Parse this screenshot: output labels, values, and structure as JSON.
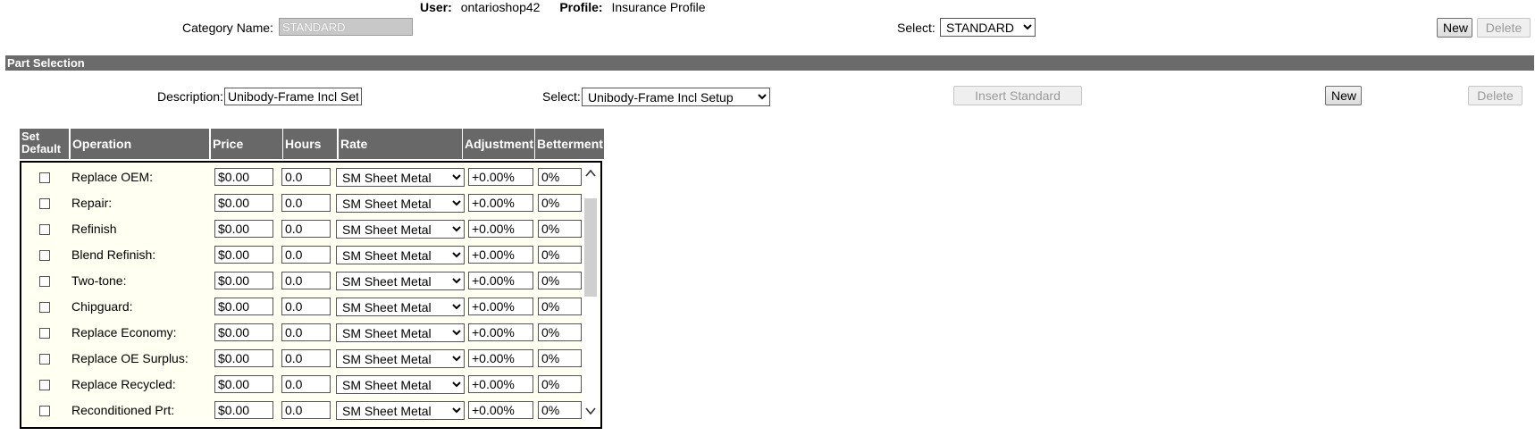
{
  "header": {
    "user_label": "User:",
    "user_value": "ontarioshop42",
    "profile_label": "Profile:",
    "profile_value": "Insurance Profile",
    "category_label": "Category Name:",
    "category_value": "STANDARD",
    "select_label": "Select:",
    "select_value": "STANDARD",
    "new_label": "New",
    "delete_label": "Delete"
  },
  "part_selection": {
    "title": "Part Selection",
    "description_label": "Description:",
    "description_value": "Unibody-Frame Incl Setup",
    "select_label": "Select:",
    "select_value": "Unibody-Frame Incl Setup",
    "insert_standard_label": "Insert Standard",
    "new_label": "New",
    "delete_label": "Delete"
  },
  "table": {
    "columns": {
      "set_default": "Set Default",
      "set_default_line1": "Set",
      "set_default_line2": "Default",
      "operation": "Operation",
      "price": "Price",
      "hours": "Hours",
      "rate": "Rate",
      "adjustment": "Adjustment",
      "betterment": "Betterment"
    },
    "rows": [
      {
        "operation": "Replace OEM:",
        "price": "$0.00",
        "hours": "0.0",
        "rate": "SM Sheet Metal",
        "adjustment": "+0.00%",
        "betterment": "0%",
        "checked": false
      },
      {
        "operation": "Repair:",
        "price": "$0.00",
        "hours": "0.0",
        "rate": "SM Sheet Metal",
        "adjustment": "+0.00%",
        "betterment": "0%",
        "checked": false
      },
      {
        "operation": "Refinish",
        "price": "$0.00",
        "hours": "0.0",
        "rate": "SM Sheet Metal",
        "adjustment": "+0.00%",
        "betterment": "0%",
        "checked": false
      },
      {
        "operation": "Blend Refinish:",
        "price": "$0.00",
        "hours": "0.0",
        "rate": "SM Sheet Metal",
        "adjustment": "+0.00%",
        "betterment": "0%",
        "checked": false
      },
      {
        "operation": "Two-tone:",
        "price": "$0.00",
        "hours": "0.0",
        "rate": "SM Sheet Metal",
        "adjustment": "+0.00%",
        "betterment": "0%",
        "checked": false
      },
      {
        "operation": "Chipguard:",
        "price": "$0.00",
        "hours": "0.0",
        "rate": "SM Sheet Metal",
        "adjustment": "+0.00%",
        "betterment": "0%",
        "checked": false
      },
      {
        "operation": "Replace Economy:",
        "price": "$0.00",
        "hours": "0.0",
        "rate": "SM Sheet Metal",
        "adjustment": "+0.00%",
        "betterment": "0%",
        "checked": false
      },
      {
        "operation": "Replace OE Surplus:",
        "price": "$0.00",
        "hours": "0.0",
        "rate": "SM Sheet Metal",
        "adjustment": "+0.00%",
        "betterment": "0%",
        "checked": false
      },
      {
        "operation": "Replace Recycled:",
        "price": "$0.00",
        "hours": "0.0",
        "rate": "SM Sheet Metal",
        "adjustment": "+0.00%",
        "betterment": "0%",
        "checked": false
      },
      {
        "operation": "Reconditioned Prt:",
        "price": "$0.00",
        "hours": "0.0",
        "rate": "SM Sheet Metal",
        "adjustment": "+0.00%",
        "betterment": "0%",
        "checked": false
      }
    ]
  },
  "colors": {
    "header_bg": "#686868",
    "grid_bg": "#fffff2",
    "disabled_input_bg": "#c8c8c8"
  },
  "icons": {
    "scroll_up": "chevron-up-icon",
    "scroll_down": "chevron-down-icon"
  }
}
